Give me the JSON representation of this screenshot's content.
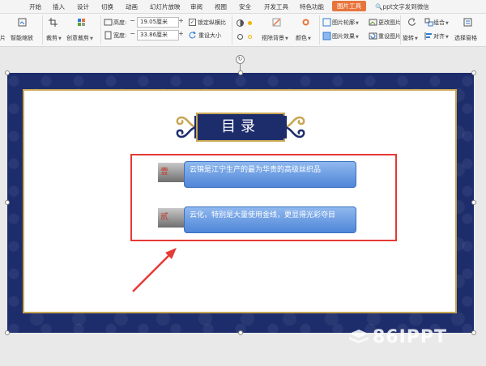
{
  "tabs": [
    {
      "label": "开始",
      "active": false
    },
    {
      "label": "插入",
      "active": false
    },
    {
      "label": "设计",
      "active": false
    },
    {
      "label": "切换",
      "active": false
    },
    {
      "label": "动画",
      "active": false
    },
    {
      "label": "幻灯片放映",
      "active": false
    },
    {
      "label": "审阅",
      "active": false
    },
    {
      "label": "视图",
      "active": false
    },
    {
      "label": "安全",
      "active": false
    },
    {
      "label": "开发工具",
      "active": false
    },
    {
      "label": "特色功能",
      "active": false
    },
    {
      "label": "图片工具",
      "active": true
    }
  ],
  "search": {
    "label": "ppt文字发到微信"
  },
  "ribbon": {
    "partial_left": "片",
    "smart_zoom": "智能缩放",
    "crop": "裁剪",
    "creative_crop": "创意裁剪",
    "height_label": "高度:",
    "height_value": "19.05厘米",
    "width_label": "宽度:",
    "width_value": "33.86厘米",
    "lock_ratio": "锁定纵横比",
    "lock_ratio_checked": true,
    "reset_size": "重设大小",
    "remove_bg": "抠除背景",
    "color": "颜色",
    "picture_outline": "图片轮廓",
    "picture_effect": "图片效果",
    "change_picture": "更改图片",
    "reset_picture": "重设图片",
    "rotate": "旋转",
    "group": "组合",
    "align": "对齐",
    "selection_pane": "选择窗格",
    "minus": "−",
    "plus": "+"
  },
  "slide": {
    "title": "目录",
    "items": [
      {
        "number": "壹",
        "text": "云锦是江宁生产的最为华贵的高级丝织品"
      },
      {
        "number": "贰",
        "text": "云化，特别是大量使用金线，更显得光彩夺目"
      }
    ]
  },
  "watermark": {
    "text": "86IPPT"
  },
  "colors": {
    "active_tab": "#e8743b",
    "slide_background": "#1d2d6c",
    "gold_border": "#c8a653",
    "item_box": "#5b8fde",
    "number_text": "#c0392b",
    "annotation_red": "#e53a35"
  }
}
